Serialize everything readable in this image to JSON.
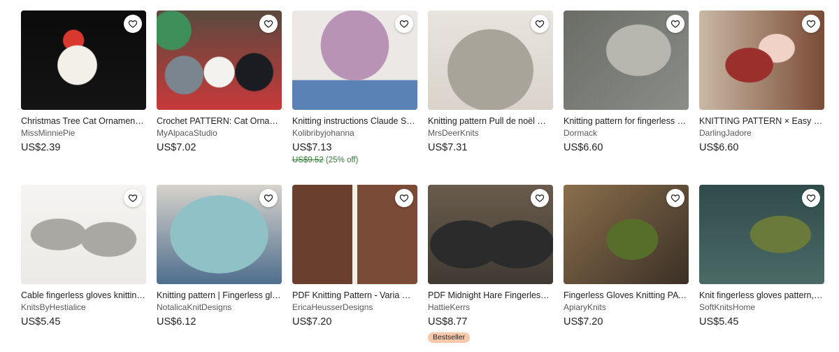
{
  "colors": {
    "sale_green": "#2f7d32",
    "badge_bg": "#f9c9ab",
    "favorite_icon": "heart-outline"
  },
  "listings": [
    {
      "title": "Christmas Tree Cat Ornament Crochet Pattern",
      "shop": "MissMinniePie",
      "price": "US$2.39"
    },
    {
      "title": "Crochet PATTERN: Cat Ornament Frame",
      "shop": "MyAlpacaStudio",
      "price": "US$7.02"
    },
    {
      "title": "Knitting instructions Claude Sweater",
      "shop": "Kolibribyjohanna",
      "price": "US$7.13",
      "original_price": "US$9.52",
      "discount": "(25% off)"
    },
    {
      "title": "Knitting pattern Pull de noël mohair",
      "shop": "MrsDeerKnits",
      "price": "US$7.31"
    },
    {
      "title": "Knitting pattern for fingerless gloves",
      "shop": "Dormack",
      "price": "US$6.60"
    },
    {
      "title": "KNITTING PATTERN × Easy Fingerless Gloves",
      "shop": "DarlingJadore",
      "price": "US$6.60"
    },
    {
      "title": "Cable fingerless gloves knitting pattern",
      "shop": "KnitsByHestialice",
      "price": "US$5.45"
    },
    {
      "title": "Knitting pattern | Fingerless gloves",
      "shop": "NotalicaKnitDesigns",
      "price": "US$6.12"
    },
    {
      "title": "PDF Knitting Pattern - Varia Mitts",
      "shop": "EricaHeusserDesigns",
      "price": "US$7.20"
    },
    {
      "title": "PDF Midnight Hare Fingerless Mitts",
      "shop": "HattieKerrs",
      "price": "US$8.77",
      "badge": "Bestseller"
    },
    {
      "title": "Fingerless Gloves Knitting PATTERN",
      "shop": "ApiaryKnits",
      "price": "US$7.20"
    },
    {
      "title": "Knit fingerless gloves pattern, easy",
      "shop": "SoftKnitsHome",
      "price": "US$5.45"
    }
  ]
}
